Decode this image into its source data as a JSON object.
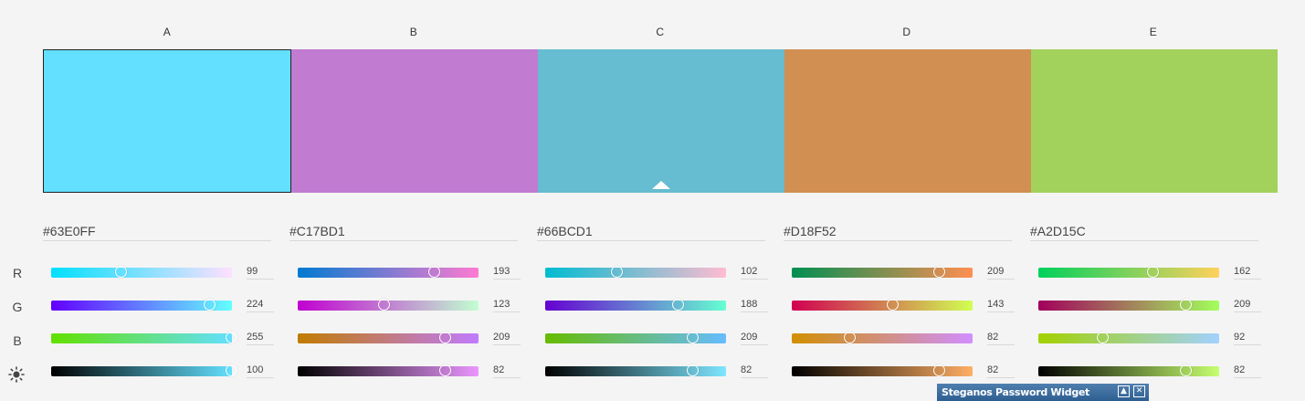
{
  "columns": [
    {
      "label": "A",
      "hex": "#63E0FF",
      "color": "#63E0FF",
      "selected": true
    },
    {
      "label": "B",
      "hex": "#C17BD1",
      "color": "#C17BD1",
      "selected": false
    },
    {
      "label": "C",
      "hex": "#66BCD1",
      "color": "#66BCD1",
      "selected": false,
      "active": true
    },
    {
      "label": "D",
      "hex": "#D18F52",
      "color": "#D18F52",
      "selected": false
    },
    {
      "label": "E",
      "hex": "#A2D15C",
      "color": "#A2D15C",
      "selected": false
    }
  ],
  "row_labels": {
    "r": "R",
    "g": "G",
    "b": "B",
    "brightness_icon": "sun-icon"
  },
  "sliders": [
    {
      "r": "99",
      "g": "224",
      "b": "255",
      "br": "100"
    },
    {
      "r": "193",
      "g": "123",
      "b": "209",
      "br": "82"
    },
    {
      "r": "102",
      "g": "188",
      "b": "209",
      "br": "82"
    },
    {
      "r": "209",
      "g": "143",
      "b": "82",
      "br": "82"
    },
    {
      "r": "162",
      "g": "209",
      "b": "92",
      "br": "82"
    }
  ],
  "widget": {
    "title": "Steganos Password Widget",
    "minimize_icon": "triangle-up-icon",
    "close_icon": "close-icon"
  }
}
